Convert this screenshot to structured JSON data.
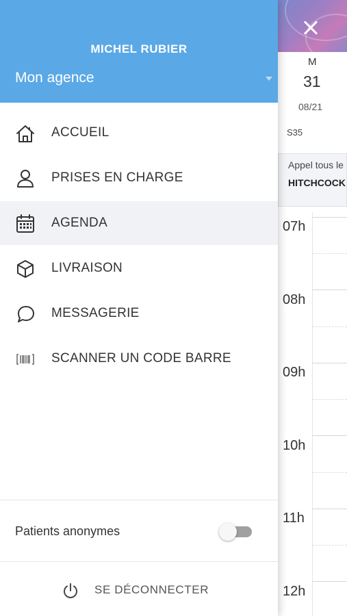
{
  "drawer": {
    "user_name": "MICHEL RUBIER",
    "agency_selected": "Mon agence",
    "menu": [
      {
        "label": "ACCUEIL",
        "icon": "home-icon",
        "active": false
      },
      {
        "label": "PRISES EN CHARGE",
        "icon": "person-icon",
        "active": false
      },
      {
        "label": "AGENDA",
        "icon": "calendar-icon",
        "active": true
      },
      {
        "label": "LIVRAISON",
        "icon": "package-icon",
        "active": false
      },
      {
        "label": "MESSAGERIE",
        "icon": "chat-icon",
        "active": false
      },
      {
        "label": "SCANNER UN CODE BARRE",
        "icon": "barcode-icon",
        "active": false
      }
    ],
    "anonymous_patients_label": "Patients anonymes",
    "anonymous_patients_enabled": false,
    "logout_label": "SE DÉCONNECTER",
    "logout_icon": "power-icon"
  },
  "agenda": {
    "close_icon": "close-icon",
    "day_letter": "M",
    "day_number": "31",
    "day_date": "08/21",
    "week_label": "S35",
    "event": {
      "line1": "Appel tous le",
      "line2": "HITCHCOCK"
    },
    "hours": [
      "07h",
      "08h",
      "09h",
      "10h",
      "11h",
      "12h"
    ]
  },
  "colors": {
    "drawer_header": "#5aa8e6",
    "active_item_bg": "#f0f2f5",
    "text": "#333333"
  }
}
